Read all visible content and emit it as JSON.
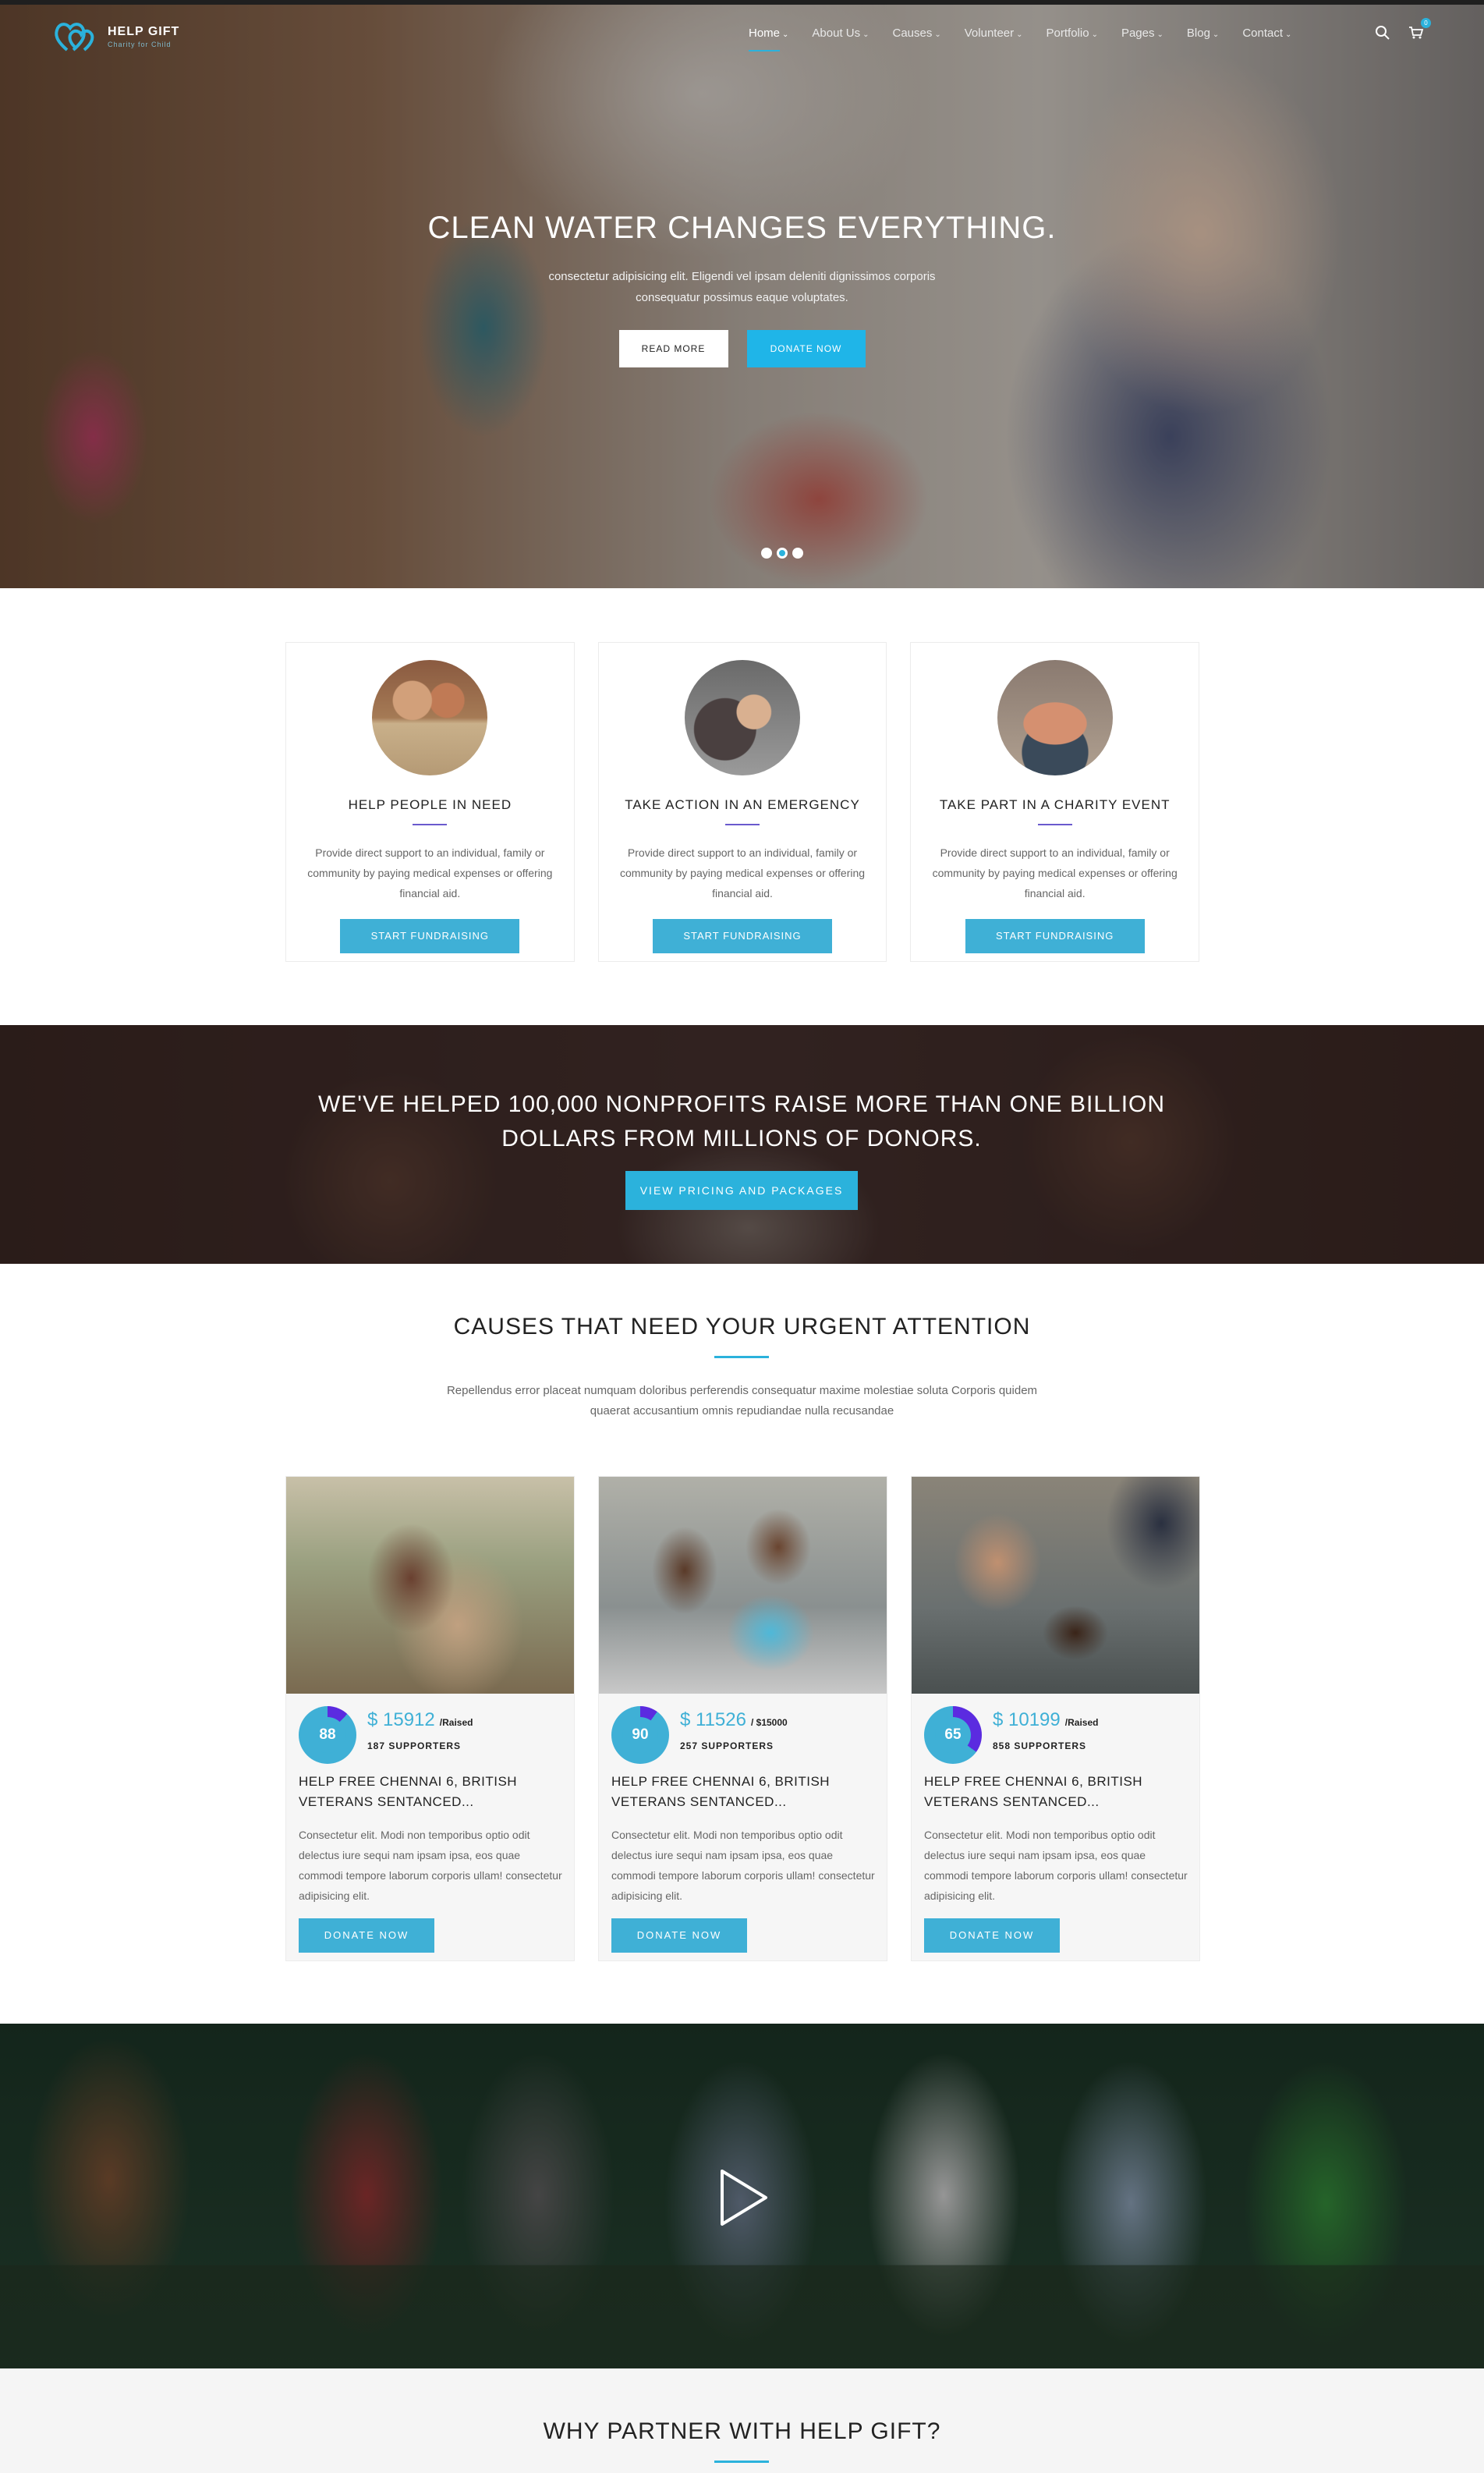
{
  "brand": {
    "name": "HELP GIFT",
    "tagline": "Charity for Child",
    "accent": "#2bb2dc"
  },
  "nav": {
    "items": [
      {
        "label": "Home",
        "active": true
      },
      {
        "label": "About Us"
      },
      {
        "label": "Causes"
      },
      {
        "label": "Volunteer"
      },
      {
        "label": "Portfolio"
      },
      {
        "label": "Pages"
      },
      {
        "label": "Blog"
      },
      {
        "label": "Contact"
      }
    ],
    "search_icon": "search-icon",
    "cart_icon": "cart-icon",
    "cart_count": "0"
  },
  "hero": {
    "title": "CLEAN WATER CHANGES EVERYTHING.",
    "text": "consectetur adipisicing elit. Eligendi vel ipsam deleniti dignissimos corporis consequatur possimus eaque voluptates.",
    "read_more": "READ MORE",
    "donate_now": "DONATE NOW",
    "slide_count": 3,
    "active_slide": 2
  },
  "features": [
    {
      "title": "HELP PEOPLE IN NEED",
      "text": "Provide direct support to an individual, family or community by paying medical expenses or offering financial aid.",
      "button": "START FUNDRAISING"
    },
    {
      "title": "TAKE ACTION IN AN EMERGENCY",
      "text": "Provide direct support to an individual, family or community by paying medical expenses or offering financial aid.",
      "button": "START FUNDRAISING"
    },
    {
      "title": "TAKE PART IN A CHARITY EVENT",
      "text": "Provide direct support to an individual, family or community by paying medical expenses or offering financial aid.",
      "button": "START FUNDRAISING"
    }
  ],
  "banner": {
    "title": "WE'VE HELPED 100,000 NONPROFITS RAISE MORE THAN ONE BILLION DOLLARS FROM MILLIONS OF DONORS.",
    "button": "VIEW PRICING AND PACKAGES"
  },
  "causes_section": {
    "title": "CAUSES THAT NEED YOUR URGENT ATTENTION",
    "text": "Repellendus error placeat numquam doloribus perferendis consequatur maxime molestiae soluta Corporis quidem quaerat accusantium omnis repudiandae nulla recusandae"
  },
  "causes": [
    {
      "percent": "88",
      "percent_value": 88,
      "raised": "$ 15912",
      "raised_suffix": "/Raised",
      "supporters": "187 SUPPORTERS",
      "title": "HELP FREE CHENNAI 6, BRITISH VETERANS SENTANCED...",
      "text": "Consectetur elit. Modi non temporibus optio odit delectus iure sequi nam ipsam ipsa, eos quae commodi tempore laborum corporis ullam! consectetur adipisicing elit.",
      "button": "DONATE NOW"
    },
    {
      "percent": "90",
      "percent_value": 90,
      "raised": "$ 11526",
      "raised_suffix": "/ $15000",
      "supporters": "257 SUPPORTERS",
      "title": "HELP FREE CHENNAI 6, BRITISH VETERANS SENTANCED...",
      "text": "Consectetur elit. Modi non temporibus optio odit delectus iure sequi nam ipsam ipsa, eos quae commodi tempore laborum corporis ullam! consectetur adipisicing elit.",
      "button": "DONATE NOW"
    },
    {
      "percent": "65",
      "percent_value": 65,
      "raised": "$ 10199",
      "raised_suffix": "/Raised",
      "supporters": "858 SUPPORTERS",
      "title": "HELP FREE CHENNAI 6, BRITISH VETERANS SENTANCED...",
      "text": "Consectetur elit. Modi non temporibus optio odit delectus iure sequi nam ipsam ipsa, eos quae commodi tempore laborum corporis ullam! consectetur adipisicing elit.",
      "button": "DONATE NOW"
    }
  ],
  "video": {
    "play_icon": "play-icon"
  },
  "partner": {
    "title": "WHY PARTNER WITH HELP GIFT?"
  },
  "colors": {
    "pie_fill": "#5b2be0",
    "pie_base": "#3fb0d6",
    "button_blue": "#3fb0d6",
    "hero_blue": "#1fb5e8"
  }
}
